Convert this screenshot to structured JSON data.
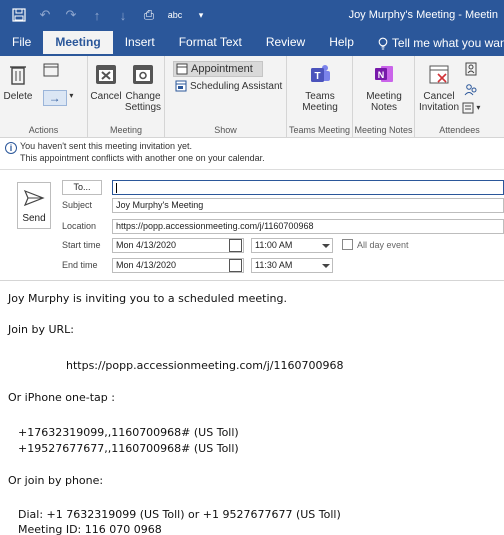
{
  "window": {
    "title": "Joy Murphy's Meeting  -  Meetin"
  },
  "tabs": [
    {
      "label": "File"
    },
    {
      "label": "Meeting"
    },
    {
      "label": "Insert"
    },
    {
      "label": "Format Text"
    },
    {
      "label": "Review"
    },
    {
      "label": "Help"
    },
    {
      "label": "Tell me what you want to"
    }
  ],
  "ribbon": {
    "actions": {
      "delete_label": "Delete",
      "group_label": "Actions"
    },
    "meeting": {
      "cancel_label": "Cancel",
      "change_settings_label_1": "Change",
      "change_settings_label_2": "Settings",
      "group_label": "Meeting"
    },
    "show": {
      "appointment_label": "Appointment",
      "scheduling_label": "Scheduling Assistant",
      "group_label": "Show"
    },
    "teams": {
      "teams_meeting_label_1": "Teams",
      "teams_meeting_label_2": "Meeting",
      "group_label": "Teams Meeting"
    },
    "notes": {
      "meeting_notes_label_1": "Meeting",
      "meeting_notes_label_2": "Notes",
      "group_label": "Meeting Notes"
    },
    "attendees": {
      "cancel_inv_label_1": "Cancel",
      "cancel_inv_label_2": "Invitation",
      "group_label": "Attendees"
    }
  },
  "infobar": {
    "line1": "You haven't sent this meeting invitation yet.",
    "line2": "This appointment conflicts with another one on your calendar."
  },
  "form": {
    "send_label": "Send",
    "to_label": "To...",
    "to_value": "",
    "subject_label": "Subject",
    "subject_value": "Joy Murphy's Meeting",
    "location_label": "Location",
    "location_value": "https://popp.accessionmeeting.com/j/1160700968",
    "start_label": "Start time",
    "start_date": "Mon 4/13/2020",
    "start_time": "11:00 AM",
    "end_label": "End time",
    "end_date": "Mon 4/13/2020",
    "end_time": "11:30 AM",
    "all_day_label": "All day event"
  },
  "body": {
    "line1": "Joy Murphy is inviting you to a scheduled meeting.",
    "line2": "Join by URL:",
    "line3": "https://popp.accessionmeeting.com/j/1160700968",
    "line4": "Or iPhone one-tap :",
    "line5": "+17632319099,,1160700968# (US Toll)",
    "line6": "+19527677677,,1160700968# (US Toll)",
    "line7": "Or join by phone:",
    "line8": "Dial: +1 7632319099 (US Toll) or +1 9527677677 (US Toll)",
    "line9": "Meeting ID: 116 070 0968"
  },
  "colors": {
    "accent": "#2b579a",
    "ribbon_bg": "#f3f3f3"
  }
}
